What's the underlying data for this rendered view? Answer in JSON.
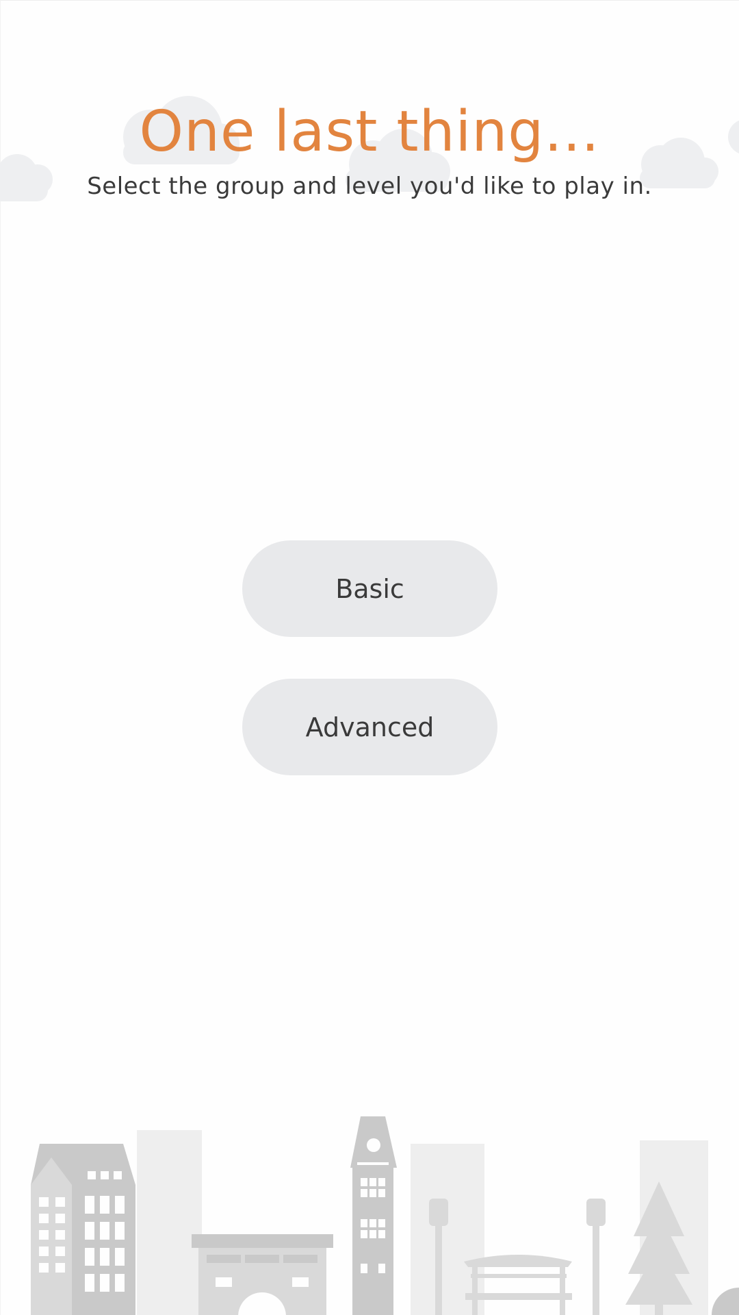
{
  "colors": {
    "accent": "#e2843f",
    "text": "#3a3a3a",
    "button_bg": "#e8e9eb",
    "cloud": "#eeeff1",
    "city_light": "#eeeeee",
    "city_mid": "#d9d9d9",
    "city_dark": "#c9c9c9"
  },
  "header": {
    "title": "One last thing...",
    "subtitle": "Select the group and level you'd like to play in."
  },
  "levels": {
    "basic_label": "Basic",
    "advanced_label": "Advanced"
  },
  "decor": {
    "background_icon": "cloud-icon",
    "scene_icon": "city-skyline-icon"
  }
}
